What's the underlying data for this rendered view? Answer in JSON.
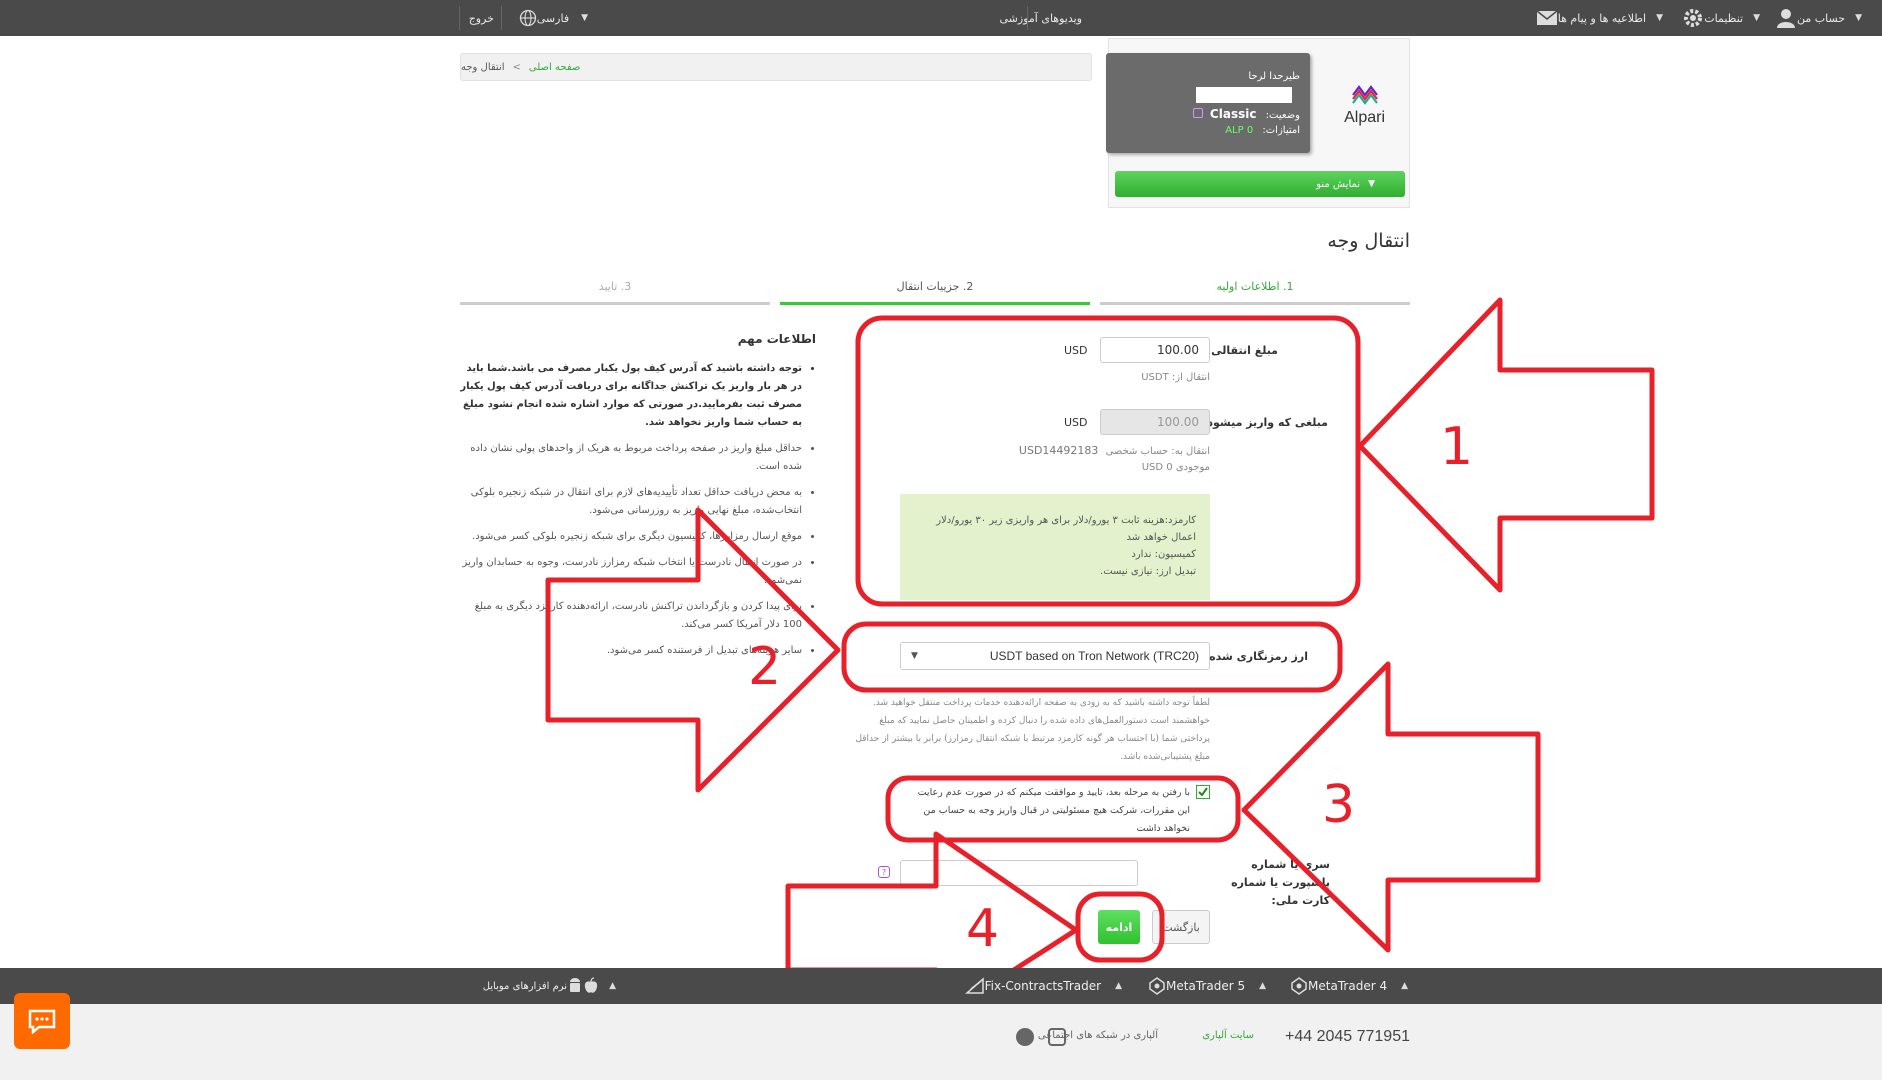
{
  "topbar": {
    "account": "حساب من",
    "settings": "تنظیمات",
    "messages": "اطلاعیه ها و پیام ها",
    "videos": "ویدیوهای آموزشی",
    "language": "فارسی",
    "logout": "خروج"
  },
  "account_card": {
    "brand": "Alpari",
    "account_name": "طیرحدا لرحا",
    "status_label": "وضعیت:",
    "status_value": "Classic",
    "points_label": "امتیازات:",
    "points_value": "ALP 0",
    "menu_button": "نمایش منو"
  },
  "breadcrumb": {
    "home": "صفحه اصلی",
    "separator": ">",
    "current": "انتقال وجه"
  },
  "page_title": "انتقال وجه",
  "steps": [
    {
      "label": "1. اطلاعات اولیه"
    },
    {
      "label": "2. جزییات انتقال"
    },
    {
      "label": "3. تایید"
    }
  ],
  "form": {
    "amount_label": "مبلغ انتقالی:",
    "amount_value": "100.00",
    "amount_currency": "USD",
    "from_note": "انتقال از: USDT",
    "deposit_label": "مبلغی که واریز میشود:",
    "deposit_value": "100.00",
    "deposit_currency": "USD",
    "to_note": "انتقال به: حساب شخصی",
    "to_account": "USD14492183",
    "balance_note": "موجودی USD 0",
    "info_items": [
      "کارمزد:هزینه ثابت ۳ یورو/دلار برای هر واریزی زیر ۳۰ یورو/دلار اعمال خواهد شد",
      "کمیسیون: ندارد",
      "تبدیل ارز: نیازی نیست."
    ],
    "crypto_label": "ارز رمزنگاری شده",
    "crypto_value": "USDT based on Tron Network (TRC20)",
    "notice_text": "لطفاً توجه داشته باشید که به زودی به صفحه ارائه‌دهنده خدمات پرداخت منتقل خواهید شد. خواهشمند است دستورالعمل‌های داده شده را دنبال کرده و اطمینان حاصل نمایید که مبلغ پرداختی شما (با احتساب هر گونه کارمزد مرتبط با شبکه انتقال رمزارز) برابر با بیشتر از حداقل مبلغ پشتیبانی‌شده باشد.",
    "agree_text": "با رفتن به مرحله بعد، تایید و موافقت میکنم که در صورت عدم رعایت این مقررات، شرکت هیچ مسئولیتی در قبال واریز وجه به حساب من نخواهد داشت",
    "passport_label": "سری یا شماره پاسپورت یا شماره کارت ملی:",
    "passport_value": "",
    "back_button": "بازگشت",
    "continue_button": "ادامه"
  },
  "important": {
    "title": "اطلاعات مهم",
    "items": [
      "توجه داشته باشید که آدرس کیف پول یکبار مصرف می باشد.شما باید در هر بار واریز یک تراکنش جداگانه برای دریافت آدرس کیف پول یکبار مصرف ثبت بفرمایید.در صورتی که موارد اشاره شده انجام نشود مبلغ به حساب شما واریز نخواهد شد.",
      "حداقل مبلغ واریز در صفحه پرداخت مربوط به هریک از واحدهای پولی نشان داده شده است.",
      "به محض دریافت حداقل تعداد تأییدیه‌های لازم برای انتقال در شبکه زنجیره بلوکی انتخاب‌شده، مبلغ نهایی واریز به روزرسانی می‌شود.",
      "موقع ارسال رمزارزها، کمیسیون دیگری برای شبکه زنجیره بلوکی کسر می‌شود.",
      "در صورت انتقال نادرست یا انتخاب شبکه رمزارز نادرست، وجوه به حسابدان واریز نمی‌شود.",
      "برای پیدا کردن و بازگرداندن تراکنش نادرست، ارائه‌دهنده کارمزد دیگری به مبلغ 100 دلار آمریکا کسر می‌کند.",
      "سایر هزینه‌های تبدیل از فرستنده کسر می‌شود."
    ]
  },
  "annotations": {
    "n1": "1",
    "n2": "2",
    "n3": "3",
    "n4": "4",
    "color": "#e8202a"
  },
  "footer": {
    "mobile": "نرم افزارهای موبایل",
    "fix": "Fix-ContractsTrader",
    "mt5": "MetaTrader 5",
    "mt4": "MetaTrader 4",
    "phone": "+44 2045 771951",
    "site": "سایت آلپاری",
    "social": "آلپاری در شبکه های اجتماعی"
  }
}
